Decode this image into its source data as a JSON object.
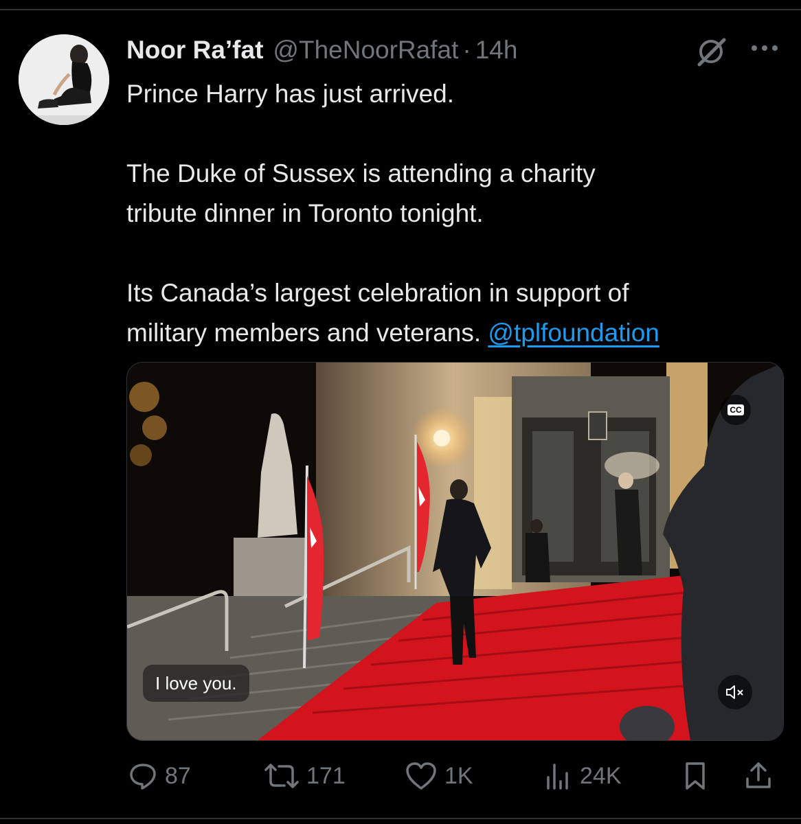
{
  "tweet": {
    "author_name": "Noor Ra’fat",
    "author_handle": "@TheNoorRafat",
    "separator": "·",
    "timestamp": "14h",
    "text_lines": {
      "p1": "Prince Harry has just arrived.",
      "p2a": "The Duke of Sussex is attending a charity",
      "p2b": "tribute dinner in Toronto tonight.",
      "p3a": "Its Canada’s largest celebration in support of",
      "p3b": "military members and veterans.",
      "mention": "@tplfoundation"
    }
  },
  "video": {
    "caption": "I love you.",
    "cc_label": "CC",
    "muted": true
  },
  "actions": {
    "replies": "87",
    "reposts": "171",
    "likes": "1K",
    "views": "24K"
  },
  "icons": [
    "grok-icon",
    "more-icon",
    "reply-icon",
    "repost-icon",
    "like-icon",
    "views-icon",
    "bookmark-icon",
    "share-icon",
    "cc-icon",
    "mute-icon"
  ],
  "colors": {
    "background": "#000000",
    "text": "#e7e9ea",
    "secondary": "#71767b",
    "link": "#1d9bf0"
  }
}
